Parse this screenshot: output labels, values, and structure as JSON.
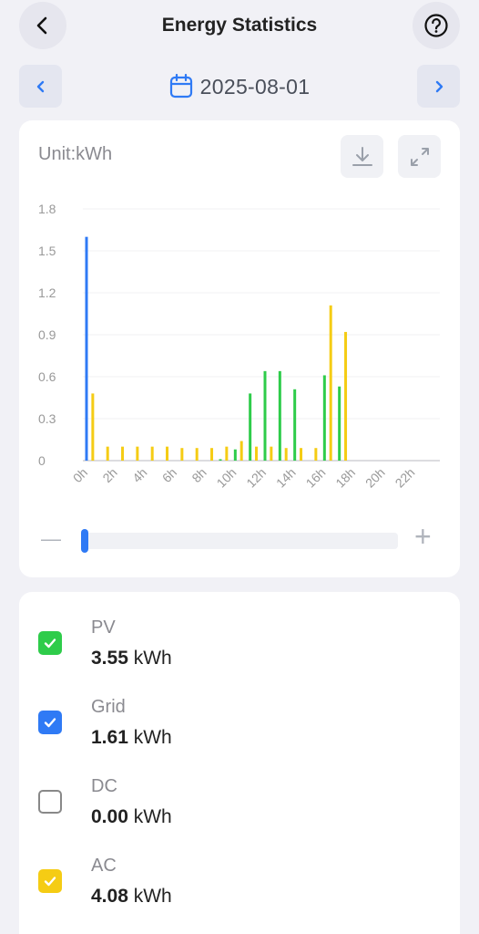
{
  "header": {
    "title": "Energy Statistics"
  },
  "date_bar": {
    "date": "2025-08-01"
  },
  "chart_card": {
    "unit_label": "Unit:kWh"
  },
  "colors": {
    "pv": "#2ecc4a",
    "grid": "#2f7af5",
    "dc": "#c8c8cc",
    "ac": "#f5cc14",
    "accent": "#2f7af5"
  },
  "chart_data": {
    "type": "bar",
    "ylim": [
      0,
      1.8
    ],
    "yticks": [
      "0",
      "0.3",
      "0.6",
      "0.9",
      "1.2",
      "1.5",
      "1.8"
    ],
    "xticks": [
      "0h",
      "2h",
      "4h",
      "6h",
      "8h",
      "10h",
      "12h",
      "14h",
      "16h",
      "18h",
      "20h",
      "22h"
    ],
    "grid": true,
    "categories": [
      "0h",
      "1h",
      "2h",
      "3h",
      "4h",
      "5h",
      "6h",
      "7h",
      "8h",
      "9h",
      "10h",
      "11h",
      "12h",
      "13h",
      "14h",
      "15h",
      "16h",
      "17h",
      "18h",
      "19h",
      "20h",
      "21h",
      "22h",
      "23h"
    ],
    "series": [
      {
        "name": "PV",
        "color": "#2ecc4a",
        "values": [
          0,
          0,
          0,
          0,
          0,
          0,
          0,
          0,
          0,
          0.01,
          0.08,
          0.48,
          0.64,
          0.64,
          0.51,
          0,
          0.61,
          0.53,
          0,
          0,
          0,
          0,
          0,
          0
        ]
      },
      {
        "name": "Grid",
        "color": "#2f7af5",
        "values": [
          1.6,
          0,
          0,
          0,
          0,
          0,
          0,
          0,
          0,
          0,
          0,
          0,
          0,
          0,
          0,
          0,
          0,
          0,
          0,
          0,
          0,
          0,
          0,
          0
        ]
      },
      {
        "name": "DC",
        "color": "#c8c8cc",
        "values": [
          0,
          0,
          0,
          0,
          0,
          0,
          0,
          0,
          0,
          0,
          0,
          0,
          0,
          0,
          0,
          0,
          0,
          0,
          0,
          0,
          0,
          0,
          0,
          0
        ]
      },
      {
        "name": "AC",
        "color": "#f5cc14",
        "values": [
          0.48,
          0.1,
          0.1,
          0.1,
          0.1,
          0.1,
          0.09,
          0.09,
          0.09,
          0.1,
          0.14,
          0.1,
          0.1,
          0.09,
          0.09,
          0.09,
          1.11,
          0.92,
          0,
          0,
          0,
          0,
          0,
          0
        ]
      }
    ]
  },
  "zoom": {
    "minus": "—",
    "plus": "+",
    "position": 0.0
  },
  "legend": [
    {
      "name": "PV",
      "value": "3.55",
      "unit": "kWh",
      "checked": true,
      "color": "#2ecc4a"
    },
    {
      "name": "Grid",
      "value": "1.61",
      "unit": "kWh",
      "checked": true,
      "color": "#2f7af5"
    },
    {
      "name": "DC",
      "value": "0.00",
      "unit": "kWh",
      "checked": false,
      "color": "#c8c8cc"
    },
    {
      "name": "AC",
      "value": "4.08",
      "unit": "kWh",
      "checked": true,
      "color": "#f5cc14"
    }
  ]
}
